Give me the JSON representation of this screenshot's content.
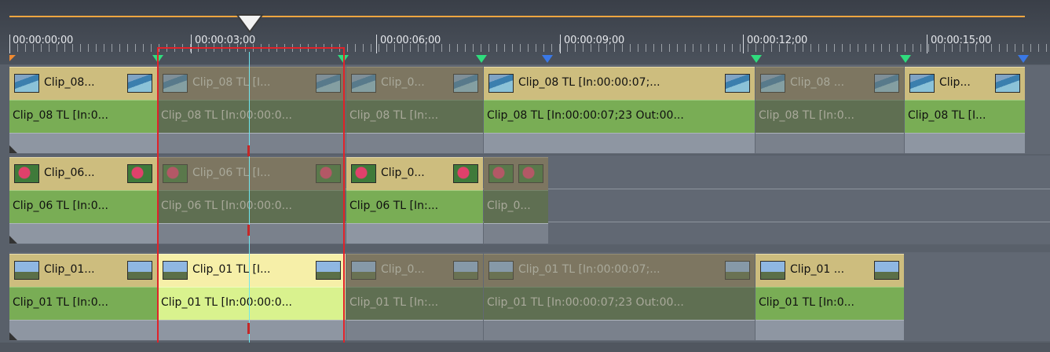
{
  "ruler": {
    "timecodes": [
      "00:00:00;00",
      "00:00:03;00",
      "00:00:06;00",
      "00:00:09;00",
      "00:00:12;00",
      "00:00:15;00"
    ]
  },
  "tracks": [
    {
      "name": "track-1",
      "clips": [
        {
          "video": "Clip_08...",
          "audio": "Clip_08  TL [In:0...",
          "state": "normal",
          "thumb": "pool"
        },
        {
          "video": "Clip_08  TL [I...",
          "audio": "Clip_08  TL [In:00:00:0...",
          "state": "dim",
          "thumb": "pool"
        },
        {
          "video": "Clip_0...",
          "audio": "Clip_08  TL [In:...",
          "state": "dim",
          "thumb": "pool"
        },
        {
          "video": "Clip_08  TL [In:00:00:07;...",
          "audio": "Clip_08  TL [In:00:00:07;23 Out:00...",
          "state": "normal",
          "thumb": "pool"
        },
        {
          "video": "Clip_08 ...",
          "audio": "Clip_08  TL [In:0...",
          "state": "dim",
          "thumb": "pool"
        },
        {
          "video": "Clip...",
          "audio": "Clip_08  TL [I...",
          "state": "normal",
          "thumb": "pool"
        }
      ]
    },
    {
      "name": "track-2",
      "clips": [
        {
          "video": "Clip_06...",
          "audio": "Clip_06  TL [In:0...",
          "state": "normal",
          "thumb": "flower"
        },
        {
          "video": "Clip_06  TL [I...",
          "audio": "Clip_06  TL [In:00:00:0...",
          "state": "dim",
          "thumb": "flower"
        },
        {
          "video": "Clip_0...",
          "audio": "Clip_06  TL [In:...",
          "state": "normal",
          "thumb": "flower"
        },
        {
          "video": "",
          "audio": "Clip_0...",
          "state": "dim",
          "thumb": "flower"
        }
      ]
    },
    {
      "name": "track-3",
      "clips": [
        {
          "video": "Clip_01...",
          "audio": "Clip_01  TL [In:0...",
          "state": "normal",
          "thumb": "tree"
        },
        {
          "video": "Clip_01  TL [I...",
          "audio": "Clip_01  TL [In:00:00:0...",
          "state": "sel",
          "thumb": "tree"
        },
        {
          "video": "Clip_0...",
          "audio": "Clip_01  TL [In:...",
          "state": "dim",
          "thumb": "tree"
        },
        {
          "video": "Clip_01  TL [In:00:00:07;...",
          "audio": "Clip_01  TL [In:00:00:07;23 Out:00...",
          "state": "dim",
          "thumb": "tree"
        },
        {
          "video": "Clip_01 ...",
          "audio": "Clip_01  TL [In:0...",
          "state": "normal",
          "thumb": "tree"
        }
      ]
    }
  ],
  "colors": {
    "selection": "#e0222a",
    "playhead_line": "#6ee6ef",
    "ruler_line": "#f0a640"
  }
}
